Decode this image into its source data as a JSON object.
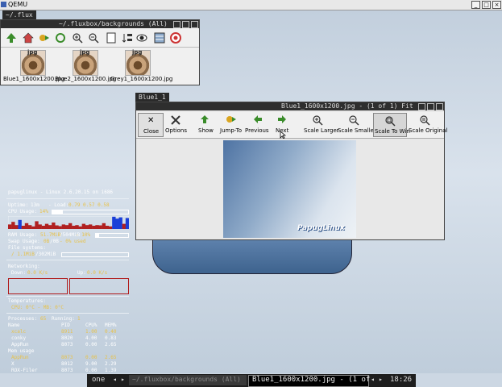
{
  "qemu": {
    "title": "QEMU",
    "btn_min": "_",
    "btn_max": "□",
    "btn_close": "×"
  },
  "flux": {
    "tab": "~/.flux",
    "title": "~/.fluxbox/backgrounds (All)",
    "files": [
      {
        "badge": "jpg",
        "name": "Blue1_1600x1200.jpg"
      },
      {
        "badge": "jpg",
        "name": "Blue2_1600x1200.jpg"
      },
      {
        "badge": "jpg",
        "name": "Grey1_1600x1200.jpg"
      }
    ]
  },
  "viewer": {
    "tab": "Blue1_1",
    "title": "Blue1_1600x1200.jpg - (1 of 1) Fit",
    "toolbar": [
      "Close",
      "Options",
      "Show",
      "Jump-To",
      "Previous",
      "Next",
      "Scale Larger",
      "Scale Smaller",
      "Scale To Win",
      "Scale Original"
    ],
    "image_text": "PapugLinux"
  },
  "conky": {
    "header": "papuglinux - Linux 2.6.20.15 on i686",
    "uptime_label": "Uptime:",
    "uptime_value": "13m",
    "load_label": "- Load:",
    "load_value": "0.79 0.57 0.58",
    "cpu_label": "CPU Usage:",
    "cpu_value": "14%",
    "ram_label": "RAM Usage:",
    "ram_value": "51.7MiB",
    "ram_total": "/504MiB",
    "ram_pct": "- 10%",
    "swap_label": "Swap Usage:",
    "swap_value": "0B",
    "swap_total": "/0B",
    "swap_pct": "- 0% used",
    "fs_label": "File systems:",
    "fs_value": "/ 1.1MiB",
    "fs_total": "/302MiB",
    "net_label": "Networking:",
    "down_label": "Down:",
    "down_value": "0.0 K/s",
    "up_label": "Up:",
    "up_value": "0.0 K/s",
    "temp_label": "Temperatures:",
    "temp_value": "CPU: 0°C - MB: 0°C",
    "proc_label": "Processes:",
    "proc_count": "65",
    "running_label": "Running:",
    "running_count": "1",
    "cols": [
      "Name",
      "PID",
      "CPU%",
      "MEM%"
    ],
    "cpu_rows": [
      {
        "name": "xcalc",
        "pid": "8911",
        "cpu": "1.00",
        "mem": "0.40",
        "hl": true
      },
      {
        "name": "conky",
        "pid": "8020",
        "cpu": "4.00",
        "mem": "0.83",
        "hl": false
      },
      {
        "name": "AppRun",
        "pid": "8073",
        "cpu": "0.00",
        "mem": "2.65",
        "hl": false
      }
    ],
    "mem_label": "Mem usage",
    "mem_rows": [
      {
        "name": "AppRun",
        "pid": "8073",
        "cpu": "0.00",
        "mem": "2.65",
        "hl": true
      },
      {
        "name": "X",
        "pid": "8012",
        "cpu": "9.00",
        "mem": "2.29",
        "hl": false
      },
      {
        "name": "ROX-Filer",
        "pid": "8073",
        "cpu": "0.00",
        "mem": "1.39",
        "hl": false
      }
    ],
    "cpu_graph": [
      0.35,
      0.55,
      0.3,
      0.7,
      0.25,
      0.45,
      0.3,
      0.2,
      0.6,
      0.35,
      0.25,
      0.4,
      0.3,
      0.5,
      0.28,
      0.22,
      0.35,
      0.3,
      0.45,
      0.25,
      0.3,
      0.2,
      0.4,
      0.3,
      0.35,
      0.25,
      0.3,
      0.28,
      0.45,
      0.25,
      0.2,
      0.95,
      0.8,
      0.9,
      0.4,
      0.85
    ]
  },
  "taskbar": {
    "workspace": "one",
    "item1": "~/.fluxbox/backgrounds (All)",
    "item2": "Blue1_1600x1200.jpg - (1 of",
    "clock": "18:26"
  },
  "colors": {
    "accent": "#e8c24a",
    "graph": "#1a3fd8",
    "panel": "#2e2e2e"
  }
}
